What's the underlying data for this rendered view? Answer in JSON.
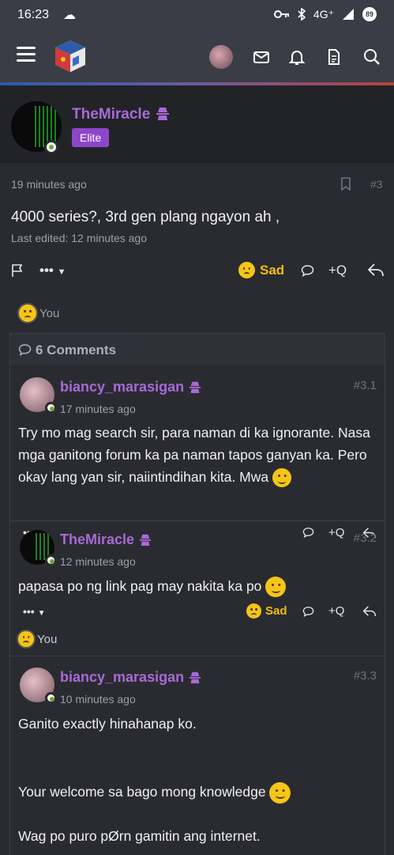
{
  "status_bar": {
    "time": "16:23",
    "network": "4G⁺",
    "battery": "89"
  },
  "nav": {
    "icons": [
      "menu-icon",
      "mail-icon",
      "bell-icon",
      "document-icon",
      "search-icon"
    ]
  },
  "post": {
    "author": "TheMiracle",
    "badge": "Elite",
    "time": "19 minutes ago",
    "number": "#3",
    "body": "4000 series?, 3rd gen plang ngayon ah ,",
    "edited": "Last edited: 12 minutes ago",
    "reaction_label": "Sad",
    "quote_label": "+Q",
    "reacted_by": "You"
  },
  "comments_header": "6 Comments",
  "comments": [
    {
      "author": "biancy_marasigan",
      "time": "17 minutes ago",
      "number": "#3.1",
      "body": "Try mo mag search sir, para naman di ka ignorante. Nasa mga ganitong forum ka pa naman tapos ganyan ka. Pero okay lang yan sir, naiintindihan kita. Mwa",
      "quote_label": "+Q"
    },
    {
      "author": "TheMiracle",
      "time": "12 minutes ago",
      "number": "#3.2",
      "body": "papasa po ng link pag may nakita ka po",
      "reaction_label": "Sad",
      "quote_label": "+Q",
      "reacted_by": "You"
    },
    {
      "author": "biancy_marasigan",
      "time": "10 minutes ago",
      "number": "#3.3",
      "body_line1": "Ganito exactly hinahanap ko.",
      "body_line2": "Your welcome sa bago mong knowledge",
      "body_line3": "Wag po puro pØrn gamitin ang internet."
    }
  ],
  "colors": {
    "accent_purple": "#a86ad6",
    "badge": "#8d46c8",
    "reaction_yellow": "#f0c000",
    "online_green": "#6ea536"
  }
}
